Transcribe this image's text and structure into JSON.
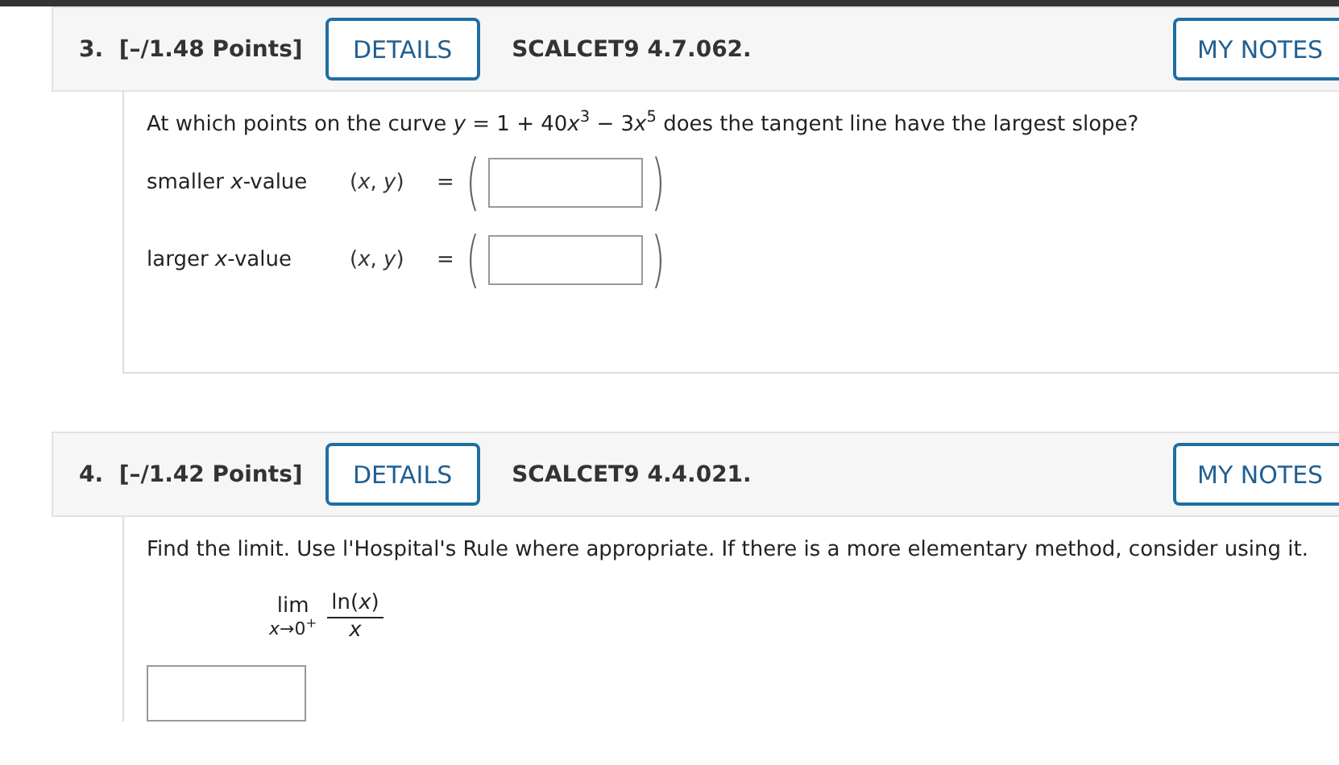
{
  "questions": [
    {
      "number": "3.",
      "points": "[–/1.48 Points]",
      "details_button": "DETAILS",
      "code": "SCALCET9 4.7.062.",
      "notes_button": "MY NOTES",
      "kind": "points",
      "prompt": [
        {
          "text": "At which points on the curve ",
          "italic": false
        },
        {
          "text": "y",
          "italic": true
        },
        {
          "text": " = 1 + 40",
          "italic": false
        },
        {
          "text": "x",
          "italic": true
        },
        {
          "text": "3",
          "italic": false,
          "raised": true
        },
        {
          "text": " − 3",
          "italic": false
        },
        {
          "text": "x",
          "italic": true
        },
        {
          "text": "5",
          "italic": false,
          "raised": true
        },
        {
          "text": " does the tangent line have the largest slope?",
          "italic": false
        }
      ],
      "rows": [
        {
          "label": "smaller *x*-value",
          "pair": "(*x*, *y*)",
          "equals": "=",
          "paren_open": "(",
          "paren_close": ")"
        },
        {
          "label": "larger *x*-value",
          "pair": "(*x*, *y*)",
          "equals": "=",
          "paren_open": "(",
          "paren_close": ")"
        }
      ]
    },
    {
      "number": "4.",
      "points": "[–/1.42 Points]",
      "details_button": "DETAILS",
      "code": "SCALCET9 4.4.021.",
      "notes_button": "MY NOTES",
      "kind": "limit",
      "prompt": "Find the limit. Use l'Hospital's Rule where appropriate. If there is a more elementary method, consider using it.",
      "limit": {
        "operator": "lim",
        "subscript": "*x*→0$^{+}$",
        "numerator": "ln(*x*)",
        "denominator": "*x*"
      }
    }
  ]
}
